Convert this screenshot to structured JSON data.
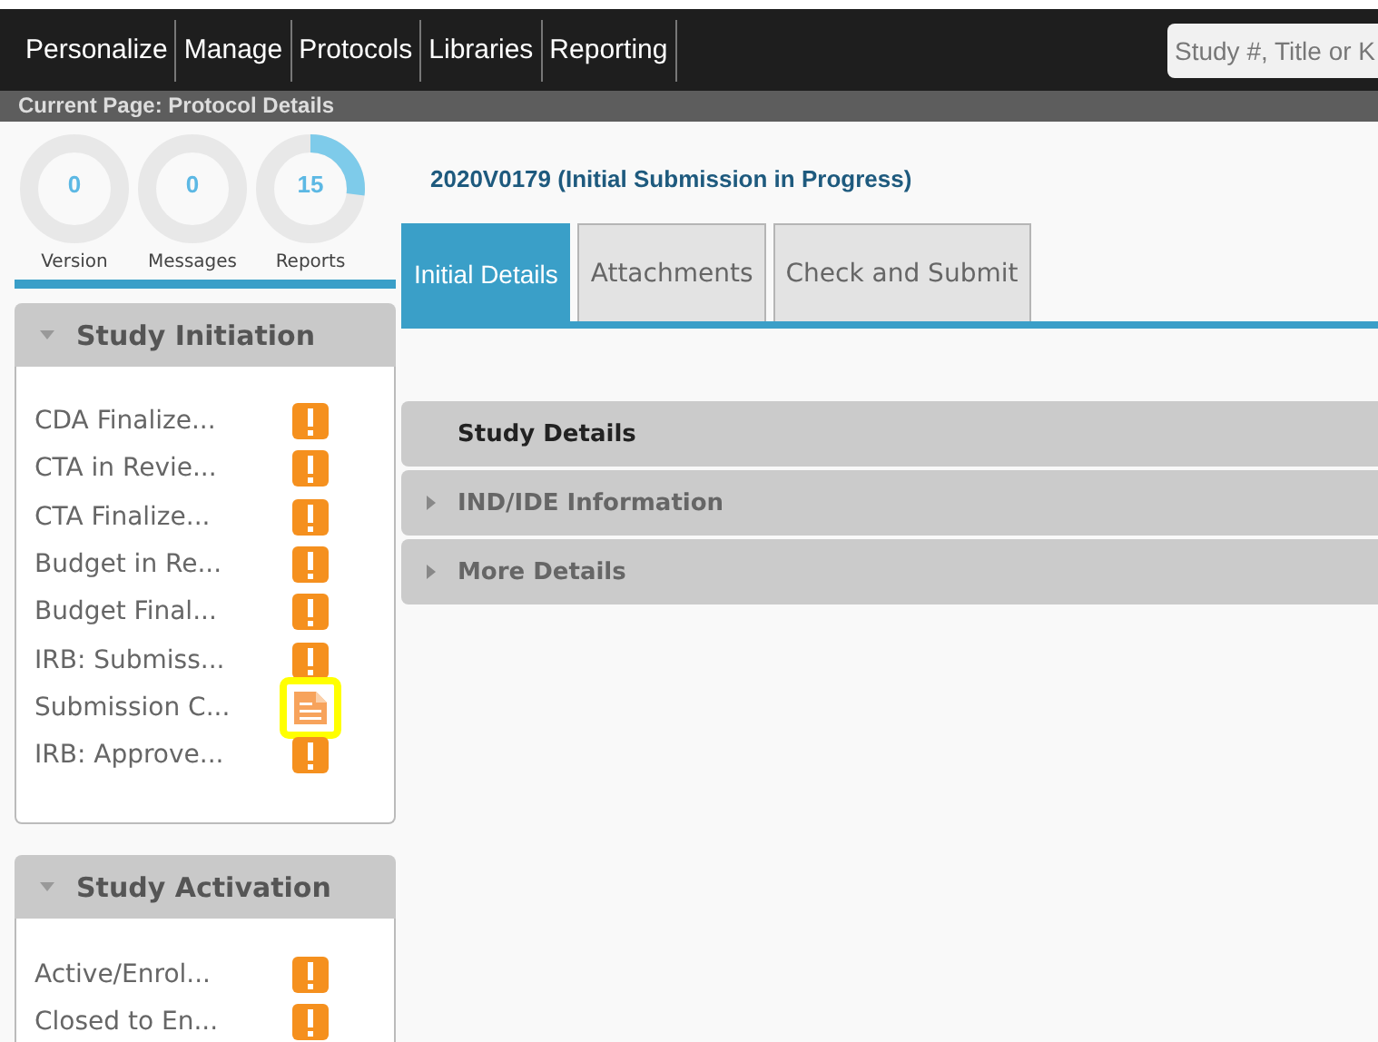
{
  "nav": {
    "items": [
      "Personalize",
      "Manage",
      "Protocols",
      "Libraries",
      "Reporting"
    ],
    "search": {
      "placeholder": "Study #, Title or K"
    }
  },
  "breadcrumb": "Current Page: Protocol Details",
  "counters": [
    {
      "value": "0",
      "label": "Version",
      "level": 0
    },
    {
      "value": "0",
      "label": "Messages",
      "level": 0
    },
    {
      "value": "15",
      "label": "Reports",
      "level": 0.27
    }
  ],
  "sections": [
    {
      "title": "Study Initiation",
      "expanded": true,
      "items": [
        {
          "label": "CDA Finalize...",
          "kind": "alert",
          "highlighted": false
        },
        {
          "label": "CTA in Revie...",
          "kind": "alert",
          "highlighted": false
        },
        {
          "label": "CTA Finalize...",
          "kind": "alert",
          "highlighted": false
        },
        {
          "label": "Budget in Re...",
          "kind": "alert",
          "highlighted": false
        },
        {
          "label": "Budget Final...",
          "kind": "alert",
          "highlighted": false
        },
        {
          "label": "IRB: Submiss...",
          "kind": "alert",
          "highlighted": false
        },
        {
          "label": "Submission C...",
          "kind": "document",
          "highlighted": true
        },
        {
          "label": "IRB: Approve...",
          "kind": "alert",
          "highlighted": false
        }
      ]
    },
    {
      "title": "Study Activation",
      "expanded": true,
      "items": [
        {
          "label": "Active/Enrol...",
          "kind": "alert",
          "highlighted": false
        },
        {
          "label": "Closed to En...",
          "kind": "alert",
          "highlighted": false
        }
      ]
    }
  ],
  "protocol_title": "2020V0179 (Initial Submission in Progress)",
  "tabs": [
    {
      "label": "Initial Details",
      "selected": true
    },
    {
      "label": "Attachments",
      "selected": false
    },
    {
      "label": "Check and Submit",
      "selected": false
    }
  ],
  "panels": [
    {
      "title": "Study Details",
      "selected": true
    },
    {
      "title": "IND/IDE Information",
      "selected": false
    },
    {
      "title": "More Details",
      "selected": false
    }
  ]
}
